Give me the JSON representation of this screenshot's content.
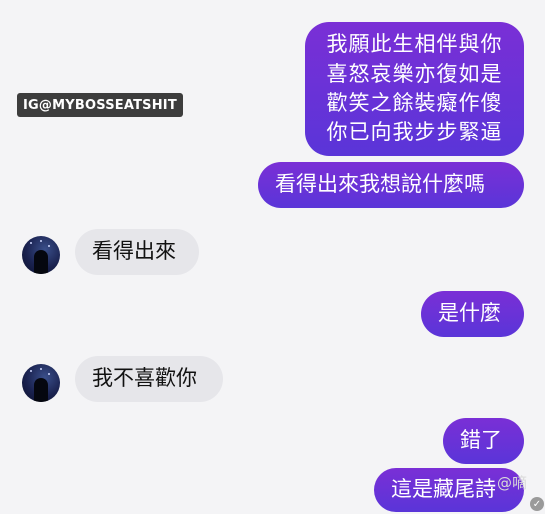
{
  "watermark": "IG@MYBOSSEATSHIT",
  "messages": {
    "m1": {
      "lines": [
        "我願此生相伴與你",
        "喜怒哀樂亦復如是",
        "歡笑之餘裝癡作傻",
        "你已向我步步緊逼"
      ]
    },
    "m2": "看得出來我想說什麼嗎",
    "m3": "看得出來",
    "m4": "是什麼",
    "m5": "我不喜歡你",
    "m6": "錯了",
    "m7": "這是藏尾詩"
  },
  "corner_mark": "@嘀",
  "colors": {
    "outgoing": "#6a32d8",
    "incoming": "#e6e6ea",
    "background": "#f4f4f6"
  }
}
